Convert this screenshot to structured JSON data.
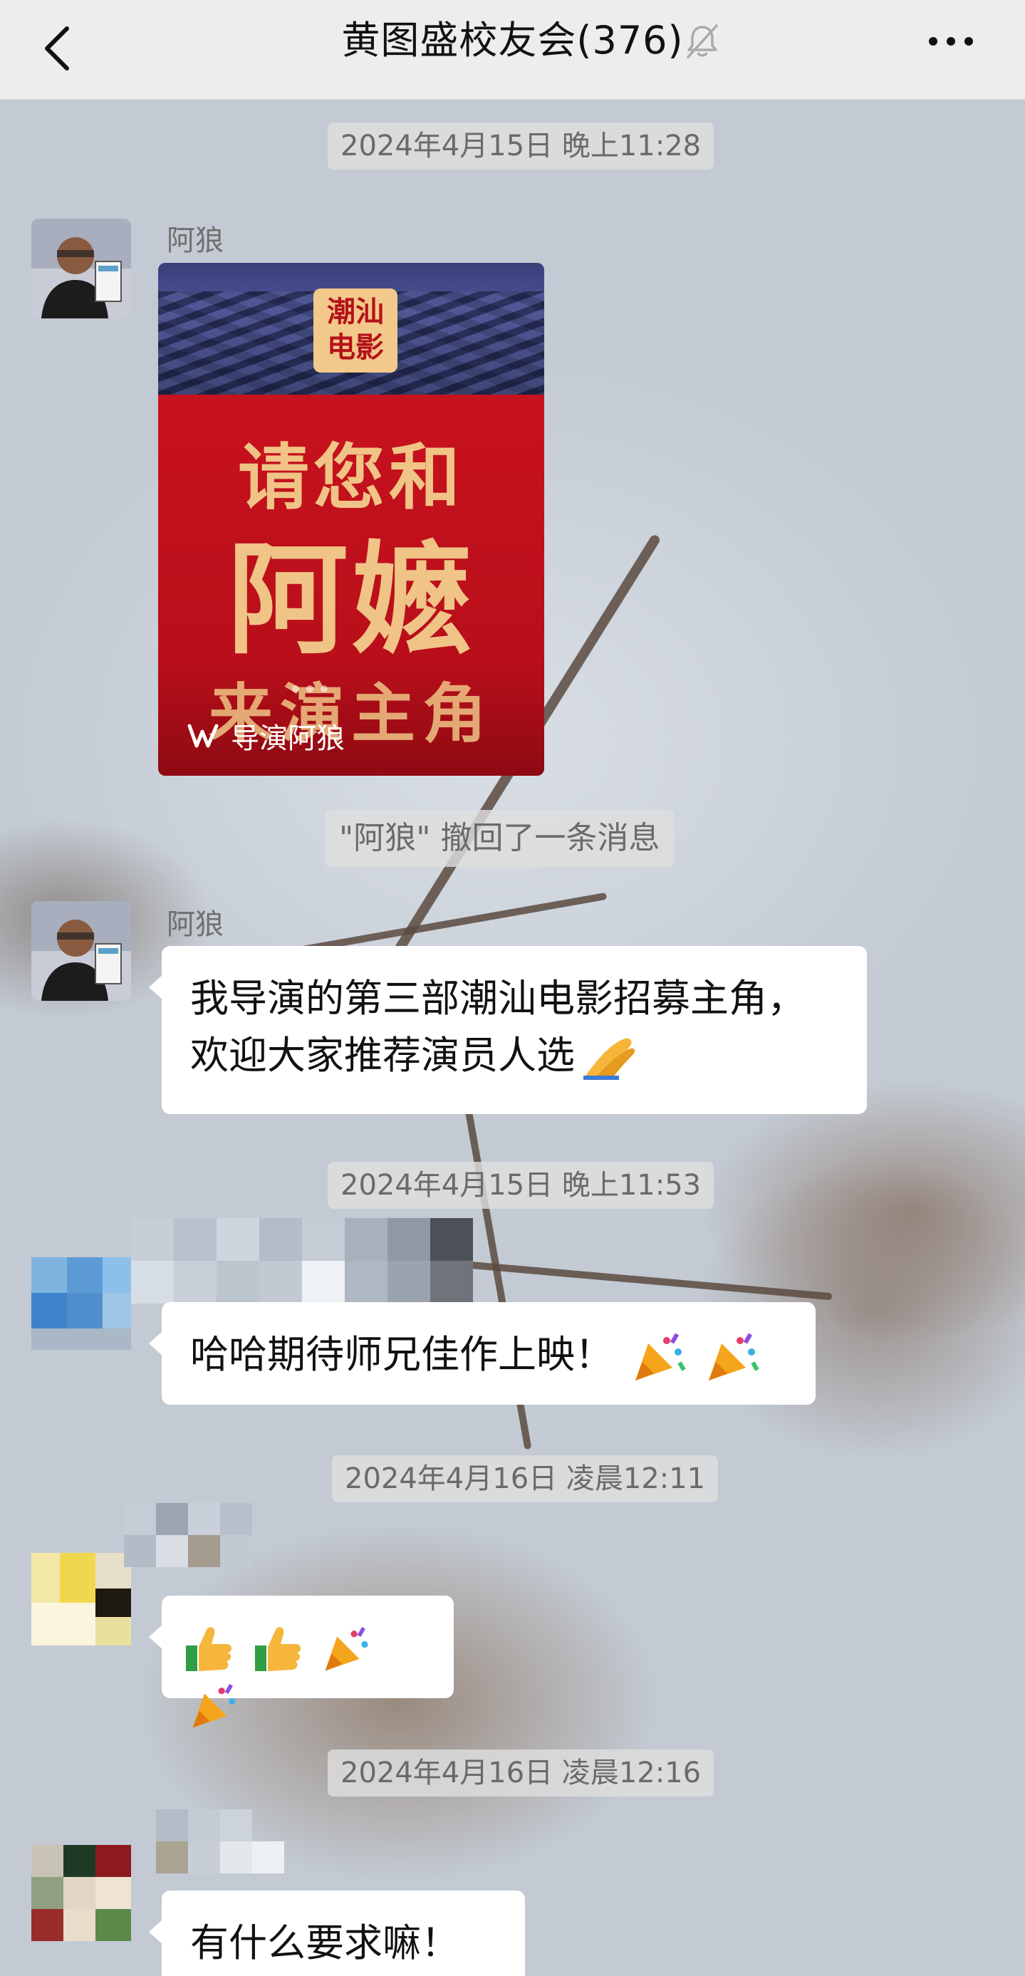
{
  "header": {
    "title": "黄图盛校友会(376)",
    "back_icon": "chevron-left-icon",
    "mute_icon": "bell-off-icon",
    "more_icon": "more-dots-icon"
  },
  "messages": {
    "ts1": "2024年4月15日 晚上11:28",
    "sender1": "阿狼",
    "card": {
      "badge_line1": "潮汕",
      "badge_line2": "电影",
      "line1": "请您和",
      "line2": "阿嬷",
      "line3": "来演主角",
      "watermark": "导演阿狼"
    },
    "recall_notice": "\"阿狼\" 撤回了一条消息",
    "sender2": "阿狼",
    "text2_line1": "我导演的第三部潮汕电影招募主角，",
    "text2_line2": "欢迎大家推荐演员人选",
    "ts2": "2024年4月15日 晚上11:53",
    "text3": "哈哈期待师兄佳作上映！",
    "ts3": "2024年4月16日 凌晨12:11",
    "ts4": "2024年4月16日 凌晨12:16",
    "text5": "有什么要求嘛！"
  },
  "colors": {
    "header_bg": "#ededed",
    "bubble_bg": "#ffffff",
    "card_red": "#c8121e",
    "card_gold": "#f0c486"
  }
}
